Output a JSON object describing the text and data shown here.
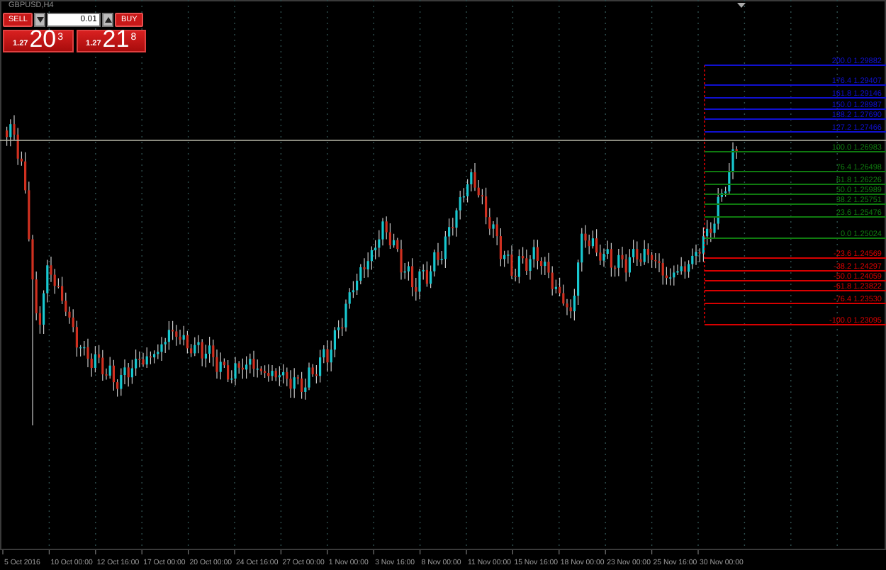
{
  "chart": {
    "title": "GBPUSD,H4"
  },
  "trade_panel": {
    "sell_label": "SELL",
    "buy_label": "BUY",
    "lot": "0.01",
    "sell_price": {
      "prefix": "1.27",
      "big": "20",
      "small": "3"
    },
    "buy_price": {
      "prefix": "1.27",
      "big": "21",
      "small": "8"
    }
  },
  "fib_levels": [
    {
      "label": "200.0  1.29882",
      "color": "#1010d0"
    },
    {
      "label": "176.4  1.29407",
      "color": "#1010d0"
    },
    {
      "label": "161.8  1.29146",
      "color": "#1010d0"
    },
    {
      "label": "150.0  1.28987",
      "color": "#1010d0"
    },
    {
      "label": "138.2  1.27690",
      "color": "#1010d0"
    },
    {
      "label": "127.2  1.27466",
      "color": "#1010d0"
    },
    {
      "label": "100.0  1.26983",
      "color": "#0f7a0f"
    },
    {
      "label": "76.4  1.26498",
      "color": "#0f7a0f"
    },
    {
      "label": "61.8  1.26226",
      "color": "#0f7a0f"
    },
    {
      "label": "50.0  1.25989",
      "color": "#0f7a0f"
    },
    {
      "label": "38.2  1.25751",
      "color": "#0f7a0f"
    },
    {
      "label": "23.6  1.25476",
      "color": "#0f7a0f"
    },
    {
      "label": "0.0  1.25024",
      "color": "#0f7a0f"
    },
    {
      "label": "-23.6  1.24569",
      "color": "#d80000"
    },
    {
      "label": "-38.2  1.24297",
      "color": "#d80000"
    },
    {
      "label": "-50.0  1.24059",
      "color": "#d80000"
    },
    {
      "label": "-61.8  1.23822",
      "color": "#d80000"
    },
    {
      "label": "-76.4  1.23530",
      "color": "#d80000"
    },
    {
      "label": "-100.0  1.23095",
      "color": "#d80000"
    }
  ],
  "time_axis": [
    "5 Oct 2016",
    "10 Oct 00:00",
    "12 Oct 16:00",
    "17 Oct 00:00",
    "20 Oct 00:00",
    "24 Oct 16:00",
    "27 Oct 00:00",
    "1 Nov 00:00",
    "3 Nov 16:00",
    "8 Nov 00:00",
    "11 Nov 00:00",
    "15 Nov 16:00",
    "18 Nov 00:00",
    "23 Nov 00:00",
    "25 Nov 16:00",
    "30 Nov 00:00"
  ]
}
